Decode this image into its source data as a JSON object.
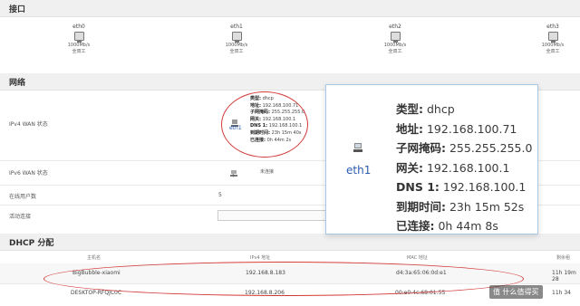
{
  "interfaces_section": {
    "title": "接口",
    "ports": [
      {
        "name": "eth0",
        "speed": "1000Mb/s",
        "duplex": "全双工"
      },
      {
        "name": "eth1",
        "speed": "1000Mb/s",
        "duplex": "全双工"
      },
      {
        "name": "eth2",
        "speed": "1000Mb/s",
        "duplex": "全双工"
      },
      {
        "name": "eth3",
        "speed": "1000Mb/s",
        "duplex": "全双工"
      }
    ]
  },
  "network_section": {
    "title": "网络",
    "ipv4_label": "IPv4 WAN 状态",
    "ipv6_label": "IPv6 WAN 状态",
    "users_label": "在线用户数",
    "users_value": "5",
    "connections_label": "活动连接",
    "ipv6_iface": "?",
    "ipv6_status": "未连接",
    "wan_small": {
      "iface": "eth1",
      "lines": [
        {
          "k": "类型:",
          "v": "dhcp"
        },
        {
          "k": "地址:",
          "v": "192.168.100.71"
        },
        {
          "k": "子网掩码:",
          "v": "255.255.255.0"
        },
        {
          "k": "网关:",
          "v": "192.168.100.1"
        },
        {
          "k": "DNS 1:",
          "v": "192.168.100.1"
        },
        {
          "k": "到期时间:",
          "v": "23h 15m 40s"
        },
        {
          "k": "已连接:",
          "v": "0h 44m 2s"
        }
      ]
    }
  },
  "popup": {
    "iface": "eth1",
    "lines": [
      {
        "k": "类型:",
        "v": "dhcp"
      },
      {
        "k": "地址:",
        "v": "192.168.100.71"
      },
      {
        "k": "子网掩码:",
        "v": "255.255.255.0"
      },
      {
        "k": "网关:",
        "v": "192.168.100.1"
      },
      {
        "k": "DNS 1:",
        "v": "192.168.100.1"
      },
      {
        "k": "到期时间:",
        "v": "23h 15m 52s"
      },
      {
        "k": "已连接:",
        "v": "0h 44m 8s"
      }
    ]
  },
  "dhcp_section": {
    "title": "DHCP 分配",
    "headers": [
      "主机名",
      "IPv4 地址",
      "MAC 地址",
      "剩余租"
    ],
    "rows": [
      {
        "host": "BigBubble-xiaomi",
        "ip": "192.168.8.183",
        "mac": "d4:3a:65:06:0d:e1",
        "lease": "11h 19m 28"
      },
      {
        "host": "DESKTOP-RFQJC0C",
        "ip": "192.168.8.206",
        "mac": "00:e0:4c:68:01:55",
        "lease": "11h 34"
      }
    ]
  },
  "watermark": "值 什么值得买"
}
